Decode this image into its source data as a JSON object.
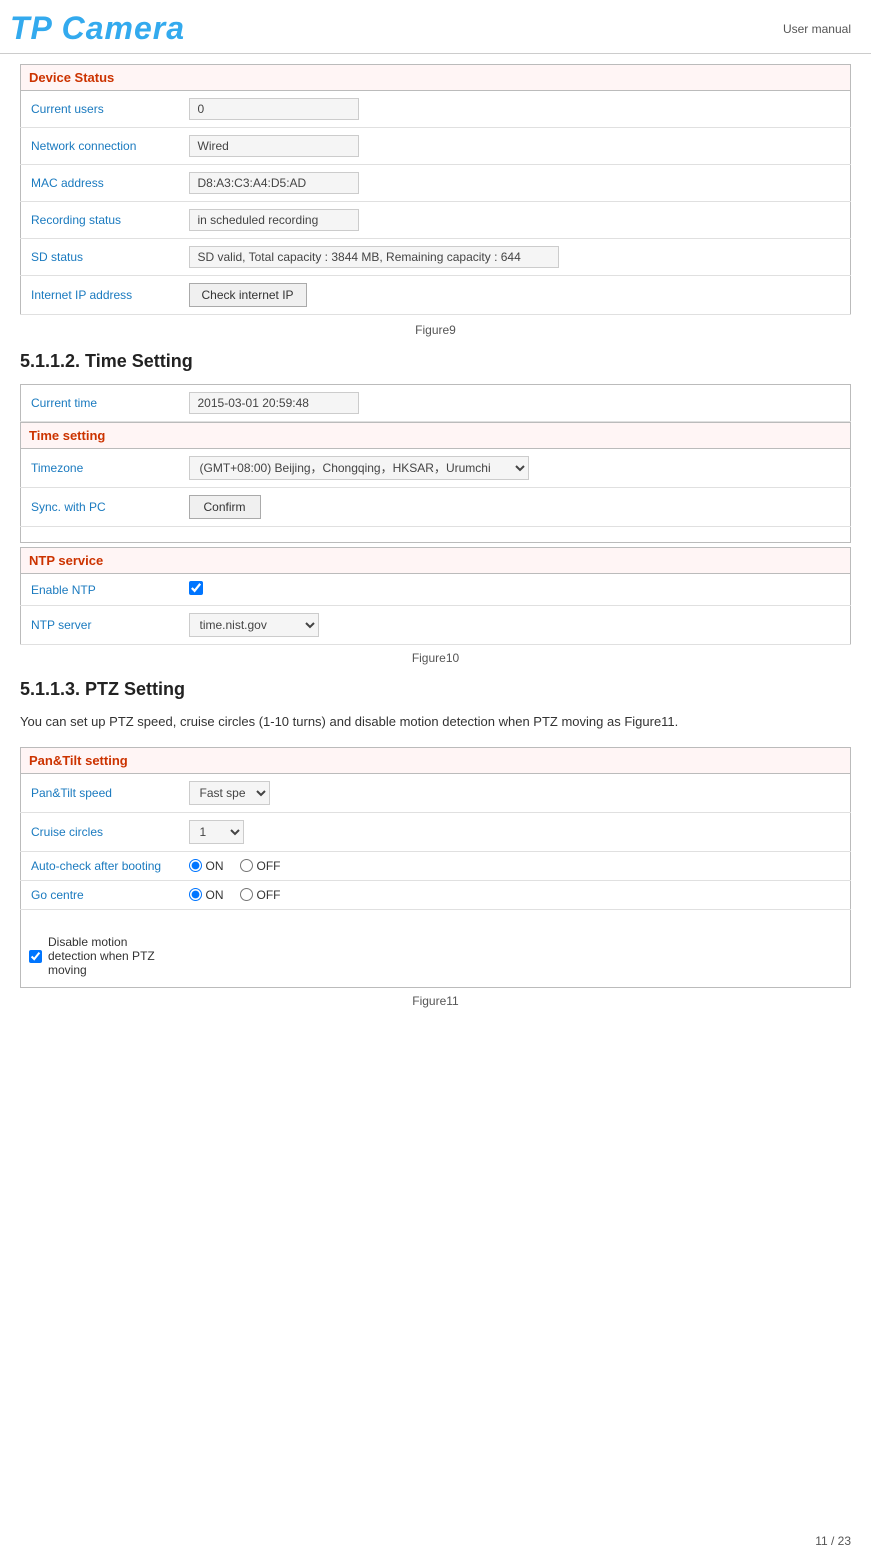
{
  "header": {
    "logo": "TP Camera",
    "manual_label": "User manual"
  },
  "device_status": {
    "section_title": "Device Status",
    "rows": [
      {
        "label": "Current users",
        "value": "0"
      },
      {
        "label": "Network connection",
        "value": "Wired"
      },
      {
        "label": "MAC address",
        "value": "D8:A3:C3:A4:D5:AD"
      },
      {
        "label": "Recording status",
        "value": "in scheduled recording"
      },
      {
        "label": "SD status",
        "value": "SD valid, Total capacity : 3844 MB, Remaining capacity : 644"
      },
      {
        "label": "Internet IP address",
        "value": ""
      }
    ],
    "check_ip_button": "Check internet IP",
    "figure_caption": "Figure9"
  },
  "time_setting_heading": "5.1.1.2. Time Setting",
  "time_setting": {
    "current_time_section": {
      "label": "Current time",
      "value": "2015-03-01 20:59:48"
    },
    "section_title": "Time setting",
    "rows": [
      {
        "label": "Timezone",
        "value": "(GMT+08:00) Beijing，Chongqing，HKSAR，Urumchi"
      },
      {
        "label": "Sync. with PC",
        "value": ""
      }
    ],
    "confirm_button": "Confirm",
    "ntp_section_title": "NTP service",
    "ntp_rows": [
      {
        "label": "Enable NTP",
        "value": ""
      },
      {
        "label": "NTP server",
        "value": "time.nist.gov"
      }
    ],
    "figure_caption": "Figure10"
  },
  "ptz_setting_heading": "5.1.1.3. PTZ Setting",
  "ptz_body_text": "You can set up PTZ speed, cruise circles (1-10 turns) and disable motion detection when PTZ moving as Figure11.",
  "ptz_setting": {
    "section_title": "Pan&Tilt setting",
    "rows": [
      {
        "label": "Pan&Tilt speed",
        "value": "Fast spe"
      },
      {
        "label": "Cruise circles",
        "value": "1"
      },
      {
        "label": "Auto-check after booting",
        "on": true
      },
      {
        "label": "Go centre",
        "on": true
      }
    ],
    "disable_motion_label": "Disable motion detection when PTZ moving",
    "figure_caption": "Figure11"
  },
  "footer": {
    "page_label": "11 / 23"
  }
}
